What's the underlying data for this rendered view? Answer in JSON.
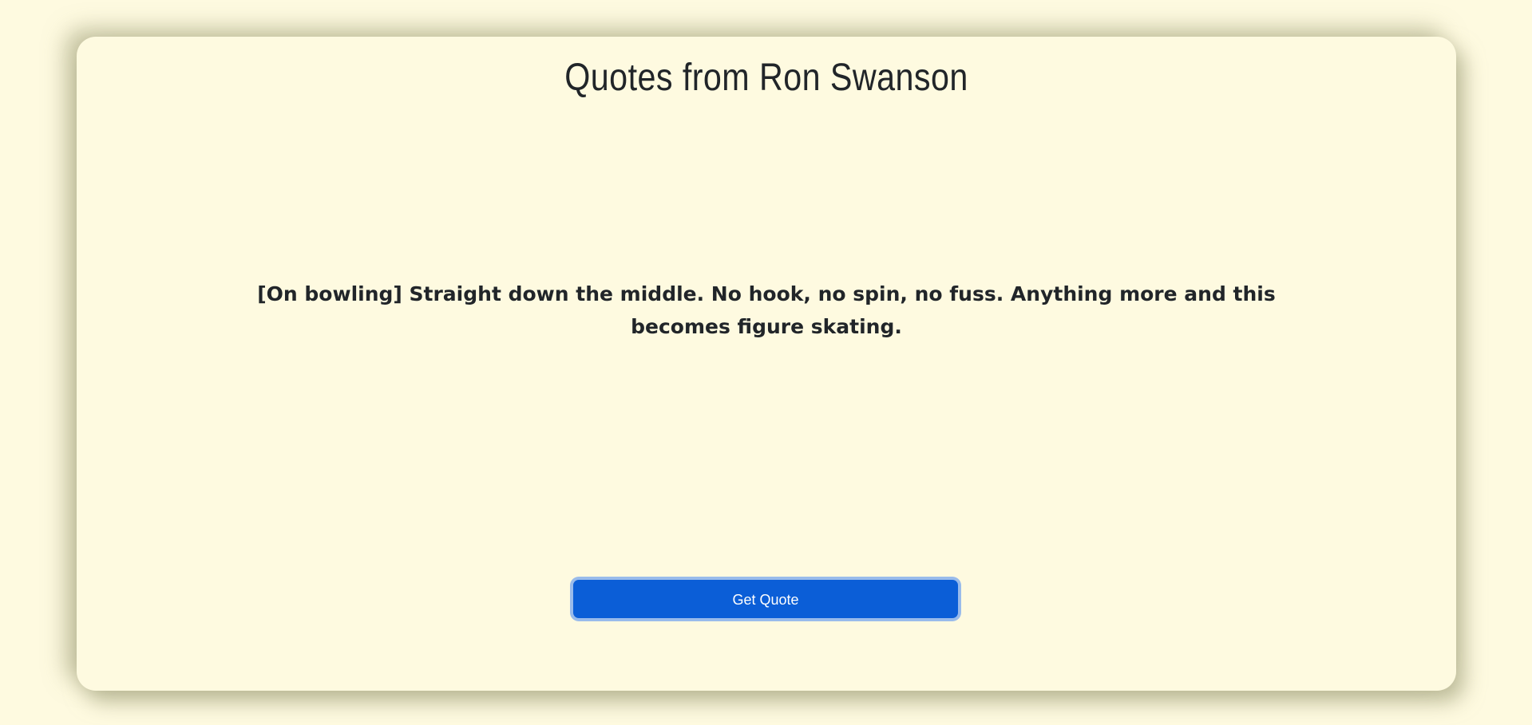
{
  "page": {
    "title": "Quotes from Ron Swanson",
    "quote": "[On bowling] Straight down the middle. No hook, no spin, no fuss. Anything more and this becomes figure skating.",
    "button_label": "Get Quote"
  },
  "colors": {
    "background": "#fefae0",
    "text": "#212529",
    "button": "#0b5ed7",
    "button_text": "#ffffff"
  }
}
